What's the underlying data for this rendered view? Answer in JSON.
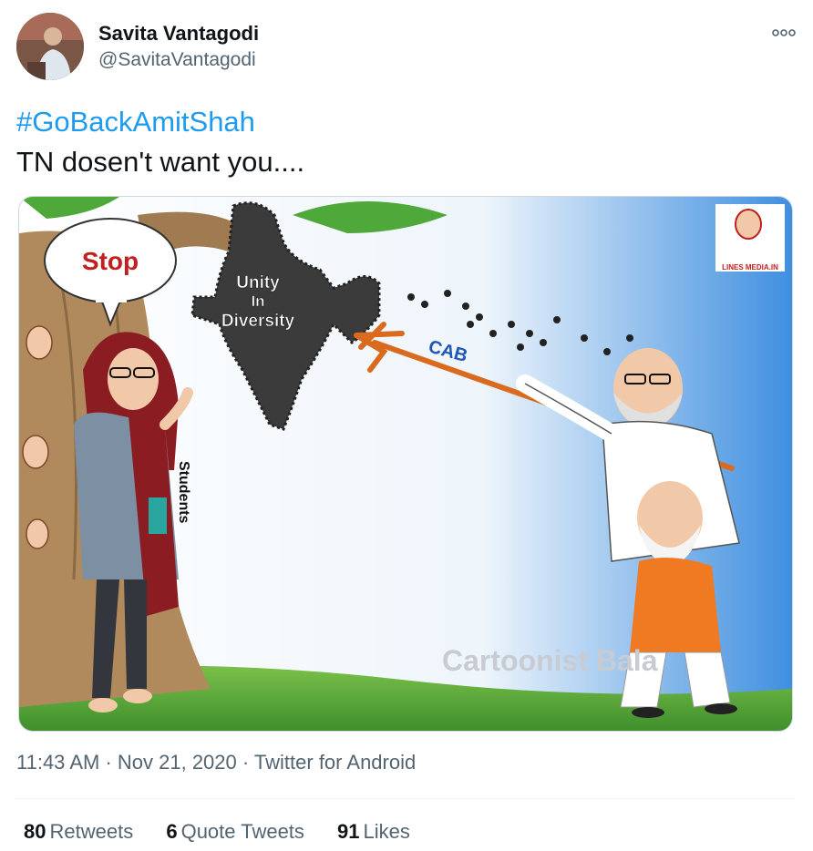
{
  "author": {
    "display_name": "Savita Vantagodi",
    "handle": "@SavitaVantagodi",
    "more_icon": "more-horizontal-icon"
  },
  "tweet": {
    "hashtag": "#GoBackAmitShah",
    "body": "TN dosen't want you...."
  },
  "media": {
    "speech_bubble": "Stop",
    "map_label_1": "Unity",
    "map_label_2": "In",
    "map_label_3": "Diversity",
    "spear_label": "CAB",
    "sash_label": "Students",
    "logo_text": "LINES MEDIA.IN",
    "watermark": "Cartoonist Bala"
  },
  "meta": {
    "time": "11:43 AM",
    "separator": " · ",
    "date": "Nov 21, 2020",
    "source": "Twitter for Android"
  },
  "stats": {
    "retweets_count": "80",
    "retweets_label": "Retweets",
    "quotes_count": "6",
    "quotes_label": "Quote Tweets",
    "likes_count": "91",
    "likes_label": "Likes"
  },
  "colors": {
    "link": "#1d9bf0",
    "text_primary": "#0f1419",
    "text_secondary": "#536471"
  }
}
